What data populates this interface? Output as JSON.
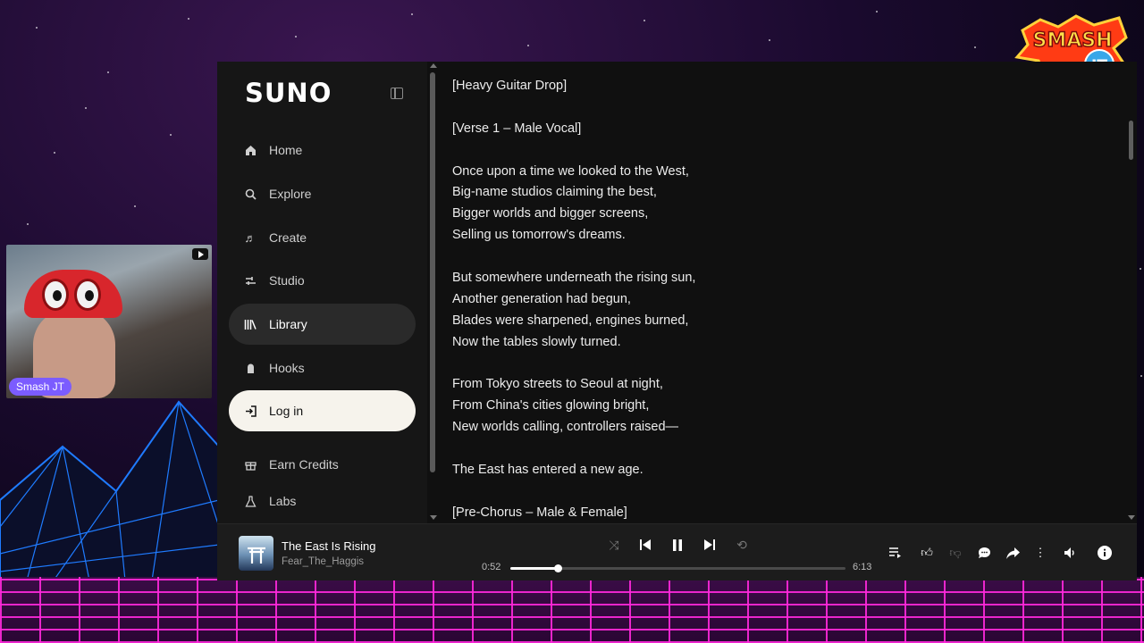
{
  "overlay": {
    "brand_logo_text": "SMASH JT",
    "webcam_name": "Smash JT"
  },
  "app": {
    "logo": "SUNO",
    "nav": [
      {
        "label": "Home",
        "icon": "home-icon"
      },
      {
        "label": "Explore",
        "icon": "search-icon"
      },
      {
        "label": "Create",
        "icon": "music-note-icon"
      },
      {
        "label": "Studio",
        "icon": "studio-icon"
      },
      {
        "label": "Library",
        "icon": "library-icon",
        "active": true
      },
      {
        "label": "Hooks",
        "icon": "hooks-icon"
      },
      {
        "label": "Log in",
        "icon": "login-icon"
      },
      {
        "label": "Earn Credits",
        "icon": "gift-icon"
      },
      {
        "label": "Labs",
        "icon": "flask-icon"
      }
    ]
  },
  "lyrics": [
    "[Heavy Guitar Drop]",
    "",
    "[Verse 1 – Male Vocal]",
    "",
    "Once upon a time we looked to the West,",
    "Big-name studios claiming the best,",
    "Bigger worlds and bigger screens,",
    "Selling us tomorrow's dreams.",
    "",
    "But somewhere underneath the rising sun,",
    "Another generation had begun,",
    "Blades were sharpened, engines burned,",
    "Now the tables slowly turned.",
    "",
    "From Tokyo streets to Seoul at night,",
    "From China's cities glowing bright,",
    "New worlds calling, controllers raised—",
    "",
    "The East has entered a new age.",
    "",
    "[Pre-Chorus – Male & Female]"
  ],
  "player": {
    "title": "The East Is Rising",
    "artist": "Fear_The_Haggis",
    "elapsed": "0:52",
    "duration": "6:13",
    "progress_fraction": 0.14,
    "controls": [
      "shuffle-icon",
      "previous-icon",
      "pause-icon",
      "next-icon",
      "repeat-icon"
    ],
    "actions": [
      "queue-icon",
      "thumbs-up-icon",
      "thumbs-down-icon",
      "comment-icon",
      "share-icon",
      "more-icon",
      "volume-icon",
      "info-icon"
    ]
  }
}
